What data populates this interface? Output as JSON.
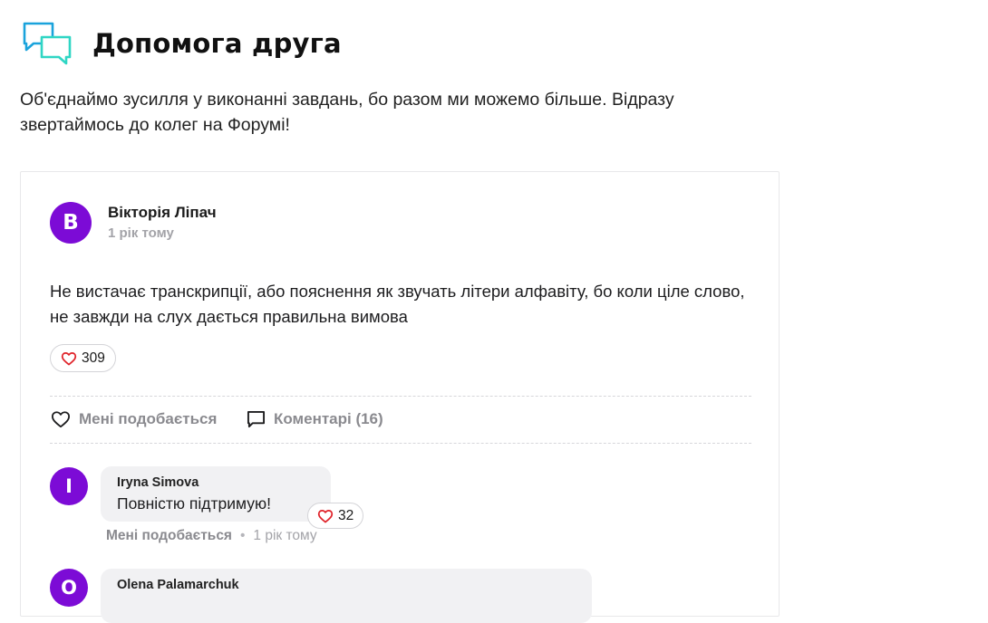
{
  "header": {
    "title": "Допомога друга",
    "icon": "chat-bubbles-icon",
    "icon_colors": [
      "#1aa3dc",
      "#2fd6c4"
    ]
  },
  "intro": "Об'єднаймо зусилля у виконанні завдань, бо разом ми можемо більше. Відразу звертаймось до колег на Форумі!",
  "post": {
    "avatar_letter": "В",
    "avatar_color": "#7c0bd6",
    "author": "Вікторія Ліпач",
    "time": "1 рік тому",
    "text": "Не вистачає транскрипції, або пояснення як звучать літери алфавіту, бо коли ціле слово, не завжди на слух дається правильна вимова",
    "likes": "309",
    "like_action": "Мені подобається",
    "comment_action": "Коментарі (16)"
  },
  "comments": [
    {
      "avatar_letter": "I",
      "author": "Iryna Simova",
      "text": "Повністю підтримую!",
      "likes": "32",
      "like_action": "Мені подобається",
      "separator": "•",
      "time": "1 рік тому"
    },
    {
      "avatar_letter": "O",
      "author": "Olena Palamarchuk"
    }
  ],
  "colors": {
    "heart": "#e0242b",
    "muted": "#8a8a8f",
    "bubble": "#f1f1f3"
  }
}
